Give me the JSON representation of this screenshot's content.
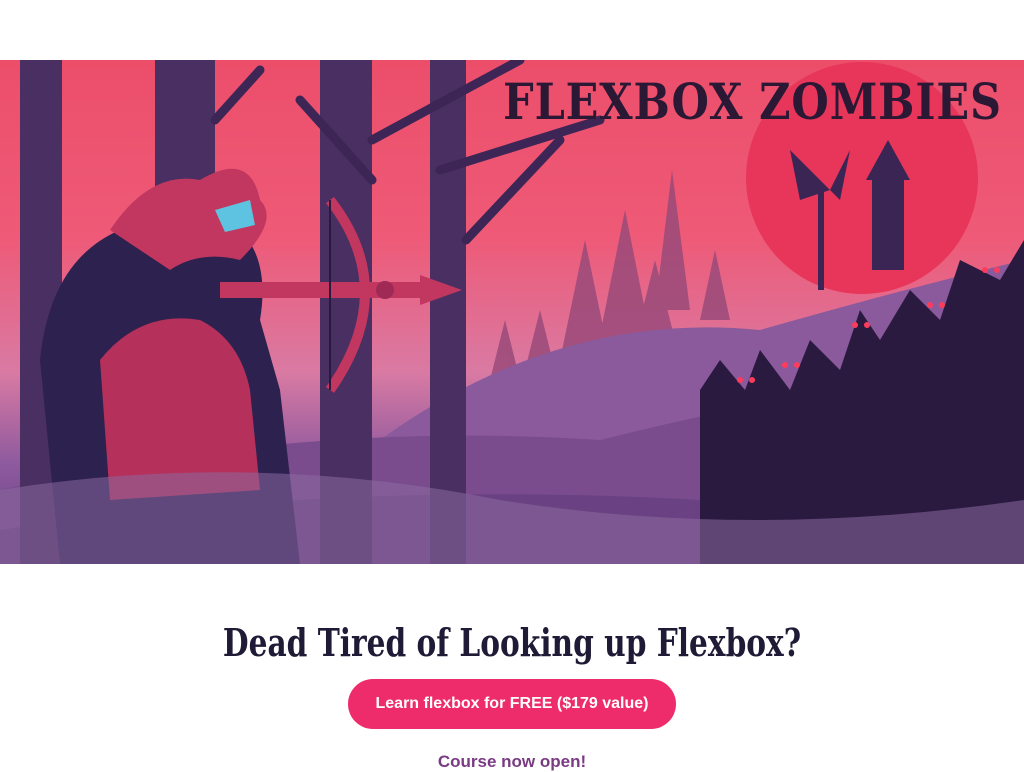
{
  "hero": {
    "logo_text": "FLEXBOX ZOMBIES"
  },
  "main": {
    "headline": "Dead Tired of Looking up Flexbox?",
    "cta_label": "Learn flexbox for FREE ($179 value)",
    "subtext": "Course now open!"
  },
  "colors": {
    "accent": "#ee2c6b",
    "headline": "#1f1a35",
    "subtext": "#7a3a84",
    "hero_sky": "#ec4e6a"
  }
}
